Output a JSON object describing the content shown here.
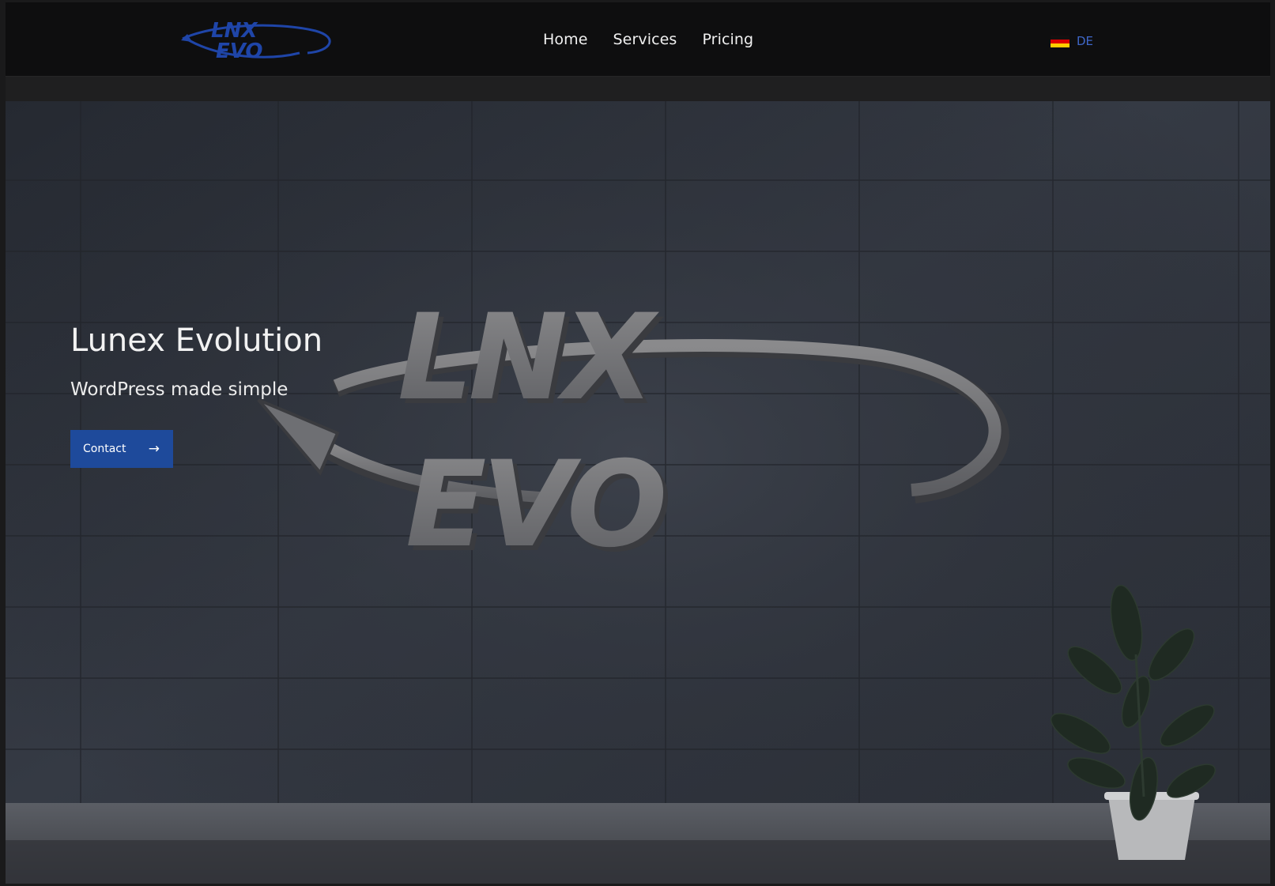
{
  "header": {
    "logo_text_top": "LNX",
    "logo_text_bottom": "EVO",
    "nav": [
      {
        "label": "Home"
      },
      {
        "label": "Services"
      },
      {
        "label": "Pricing"
      }
    ],
    "language": {
      "label": "DE",
      "flag_icon": "germany-flag-icon"
    }
  },
  "hero": {
    "title": "Lunex Evolution",
    "subtitle": "WordPress made simple",
    "cta_label": "Contact",
    "cta_icon": "arrow-right-icon",
    "sign_text_top": "LNX",
    "sign_text_bottom": "EVO"
  },
  "colors": {
    "header_bg": "#0e0e0f",
    "accent_blue": "#1e4a9b",
    "lang_blue": "#3f67c9",
    "hero_bg": "#2e323a"
  }
}
